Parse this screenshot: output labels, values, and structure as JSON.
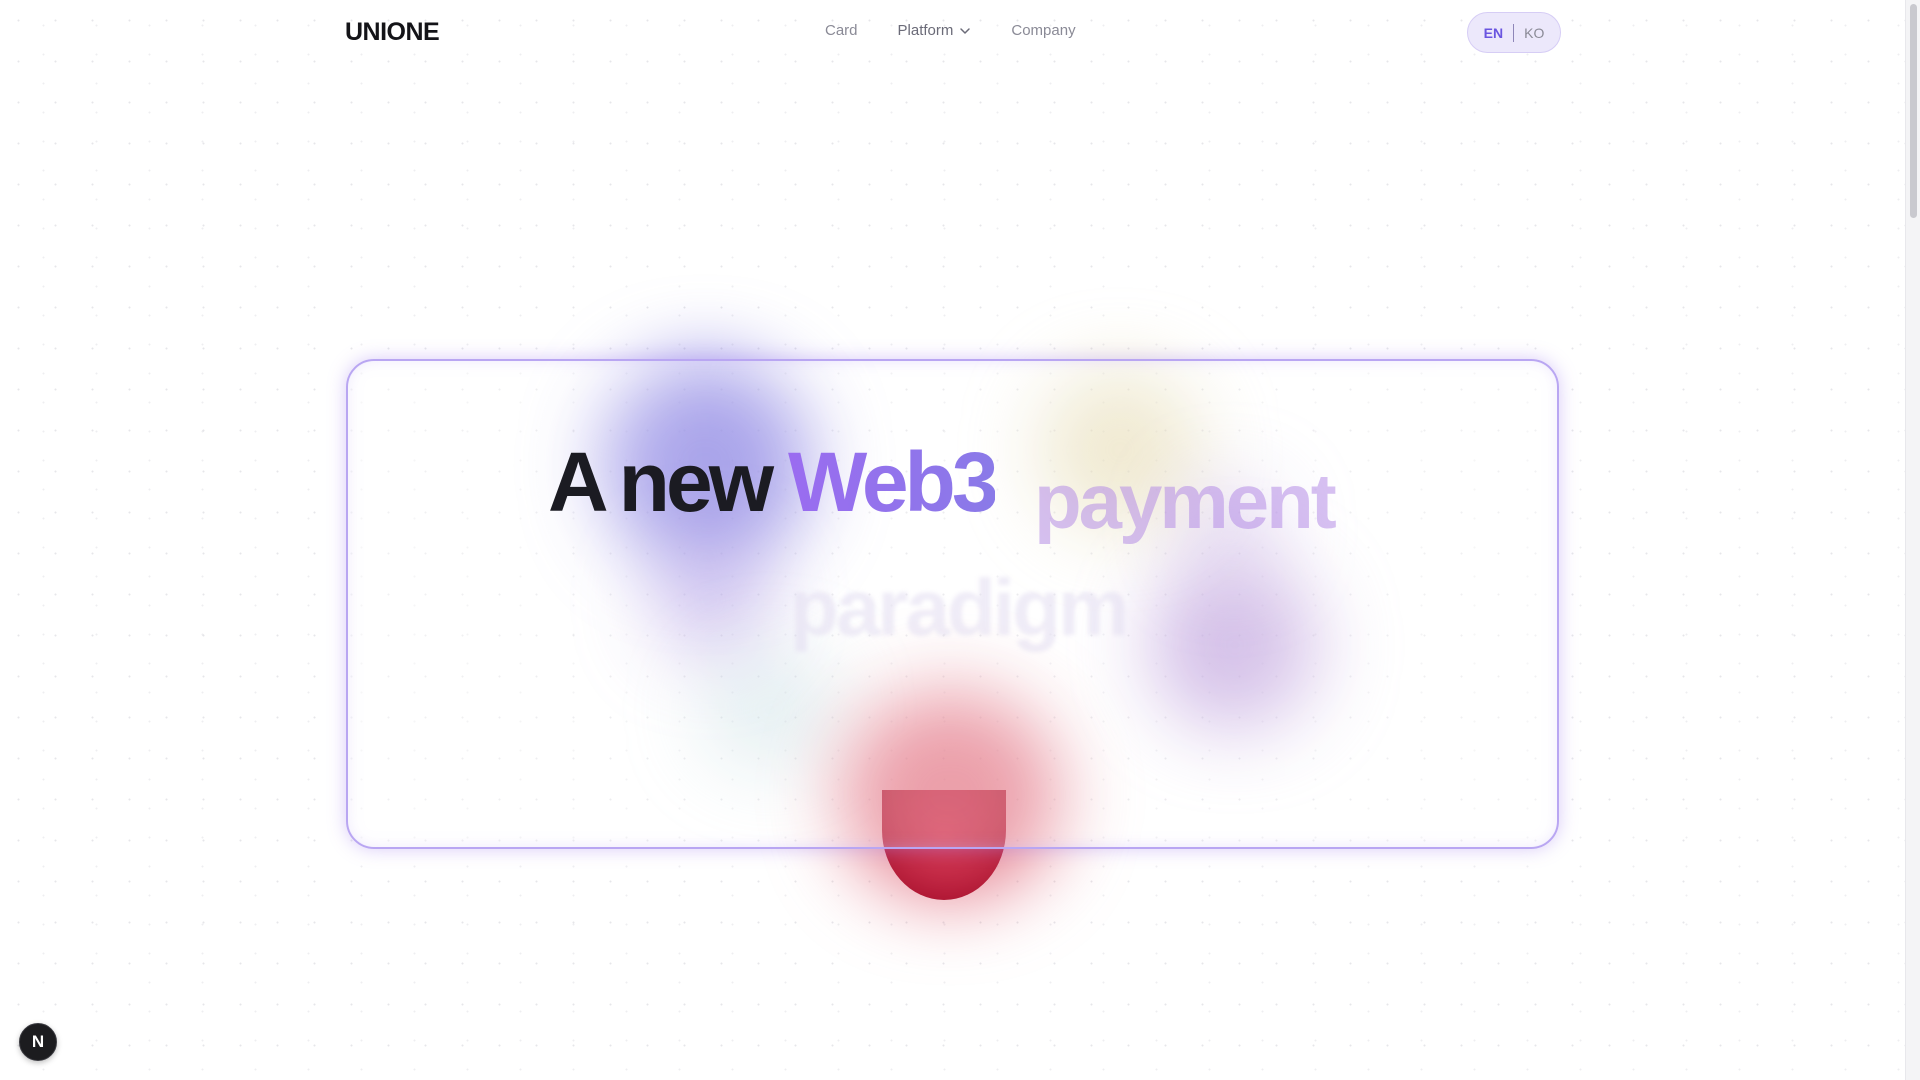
{
  "header": {
    "logo": "UNIONE",
    "nav": [
      {
        "label": "Card"
      },
      {
        "label": "Platform",
        "has_dropdown": true,
        "icon": "chevron-down-icon"
      },
      {
        "label": "Company"
      }
    ],
    "lang": {
      "active": "EN",
      "other": "KO"
    }
  },
  "hero": {
    "word1": "A",
    "word2": "new",
    "word3": "Web3",
    "word4": "payment",
    "word5": "paradigm"
  },
  "dev_badge": {
    "letter": "N",
    "icon": "nextjs-icon"
  },
  "colors": {
    "accent": "#6a55e0",
    "web3_gradient_start": "#9a6cf0",
    "card_border": "#b9a6f2",
    "drop": "#a10022"
  }
}
